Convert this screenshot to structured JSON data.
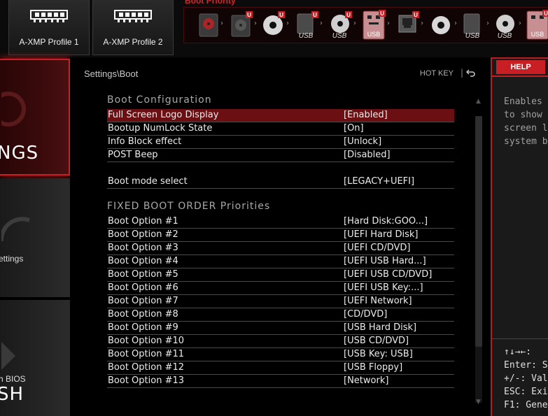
{
  "top_bar": {
    "xmp_profile_1": "A-XMP Profile 1",
    "xmp_profile_2": "A-XMP Profile 2",
    "boot_priority_title": "Boot Priority",
    "boot_devices": [
      {
        "icon": "hdd-icon",
        "label": ""
      },
      {
        "icon": "hdd-u-icon",
        "label": ""
      },
      {
        "icon": "cd-icon",
        "label": ""
      },
      {
        "icon": "usb-hdd-icon",
        "label": "USB"
      },
      {
        "icon": "usb-cd-icon",
        "label": "USB"
      },
      {
        "icon": "usb-key-icon",
        "label": "USB"
      },
      {
        "icon": "network-icon",
        "label": ""
      },
      {
        "icon": "cd-icon",
        "label": ""
      },
      {
        "icon": "usb-hdd-icon",
        "label": "USB"
      },
      {
        "icon": "usb-cd-icon",
        "label": "USB"
      },
      {
        "icon": "usb-key-icon",
        "label": "USB"
      }
    ]
  },
  "sidebar": {
    "settings_label": "NGS",
    "oc_label": "ettings",
    "mflash_small": "h BIOS",
    "mflash_big": "SH"
  },
  "main": {
    "breadcrumb": "Settings\\Boot",
    "hotkey_label": "HOT KEY",
    "hotkey_sep": "|",
    "boot_config_header": "Boot  Configuration",
    "boot_config_rows": [
      {
        "label": "Full Screen Logo Display",
        "value": "[Enabled]"
      },
      {
        "label": "Bootup NumLock State",
        "value": "[On]"
      },
      {
        "label": "Info Block effect",
        "value": "[Unlock]"
      },
      {
        "label": "POST Beep",
        "value": "[Disabled]"
      }
    ],
    "boot_mode": {
      "label": "Boot mode select",
      "value": "[LEGACY+UEFI]"
    },
    "fixed_order_header": "FIXED  BOOT  ORDER  Priorities",
    "boot_options": [
      {
        "label": "Boot Option #1",
        "value": "[Hard Disk:GOO...]"
      },
      {
        "label": "Boot Option #2",
        "value": "[UEFI Hard Disk]"
      },
      {
        "label": "Boot Option #3",
        "value": "[UEFI CD/DVD]"
      },
      {
        "label": "Boot Option #4",
        "value": "[UEFI USB Hard...]"
      },
      {
        "label": "Boot Option #5",
        "value": "[UEFI USB CD/DVD]"
      },
      {
        "label": "Boot Option #6",
        "value": "[UEFI USB Key:...]"
      },
      {
        "label": "Boot Option #7",
        "value": "[UEFI Network]"
      },
      {
        "label": "Boot Option #8",
        "value": "[CD/DVD]"
      },
      {
        "label": "Boot Option #9",
        "value": "[USB Hard Disk]"
      },
      {
        "label": "Boot Option #10",
        "value": "[USB CD/DVD]"
      },
      {
        "label": "Boot Option #11",
        "value": "[USB Key: USB]"
      },
      {
        "label": "Boot Option #12",
        "value": "[USB Floppy]"
      },
      {
        "label": "Boot Option #13",
        "value": "[Network]"
      }
    ]
  },
  "help": {
    "tab": "HELP",
    "text": "Enables\nto show\nscreen l\nsystem b",
    "keys": "↑↓→←: \nEnter: S\n+/-: Valu\nESC: Exi\nF1: Gene"
  },
  "colors": {
    "accent": "#c81f24",
    "selected_row": "#6b0f12",
    "background": "#000000"
  }
}
